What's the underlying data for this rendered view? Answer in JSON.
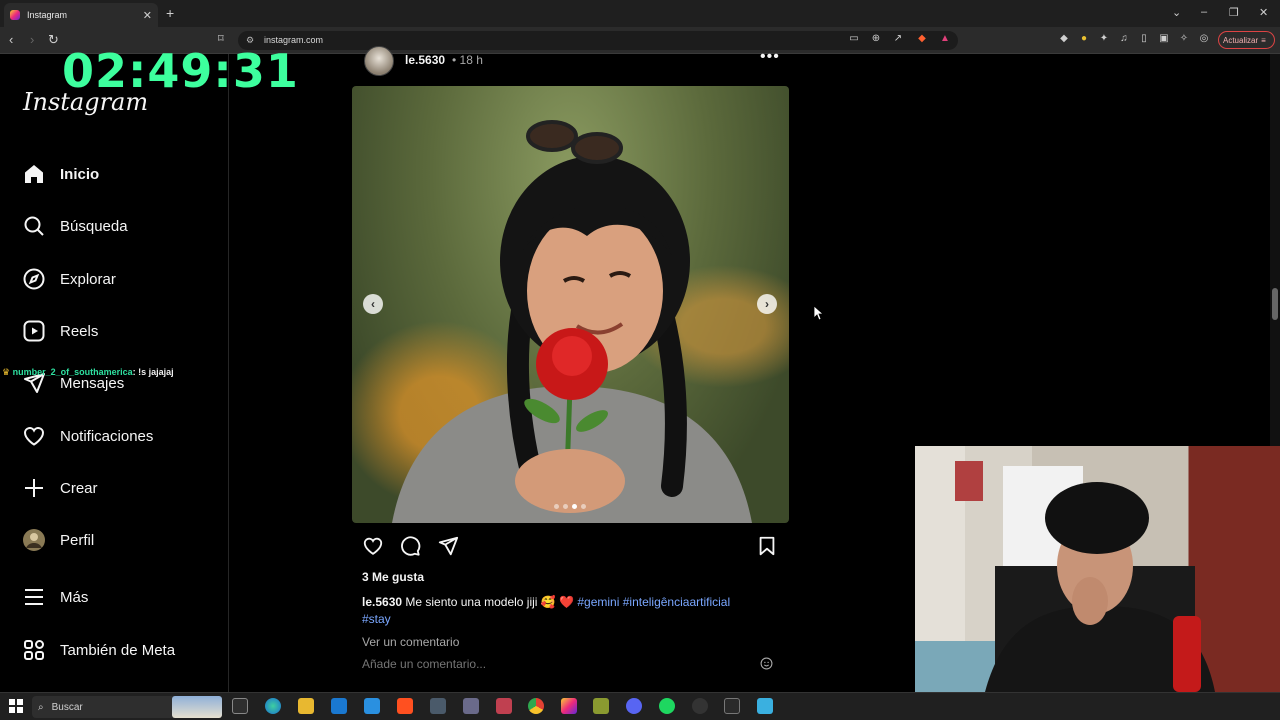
{
  "browser": {
    "tab_title": "Instagram",
    "new_tab_icon": "plus-icon",
    "url": "instagram.com",
    "update_label": "Actualizar"
  },
  "overlay": {
    "timer": "02:49:31",
    "chat_user": "number_2_of_southamerica",
    "chat_message": ": !s jajajaj"
  },
  "sidebar": {
    "logo": "Instagram",
    "items": [
      {
        "label": "Inicio",
        "icon": "home-icon"
      },
      {
        "label": "Búsqueda",
        "icon": "search-icon"
      },
      {
        "label": "Explorar",
        "icon": "compass-icon"
      },
      {
        "label": "Reels",
        "icon": "reels-icon"
      },
      {
        "label": "Mensajes",
        "icon": "messages-icon"
      },
      {
        "label": "Notificaciones",
        "icon": "heart-icon"
      },
      {
        "label": "Crear",
        "icon": "plus-icon"
      },
      {
        "label": "Perfil",
        "icon": "avatar-icon"
      },
      {
        "label": "Más",
        "icon": "menu-icon"
      },
      {
        "label": "También de Meta",
        "icon": "meta-apps-icon"
      }
    ]
  },
  "post": {
    "username": "le.5630",
    "time": "• 18 h",
    "likes": "3 Me gusta",
    "caption_user": "le.5630",
    "caption_text": "Me siento una modelo jiji 🥰 ❤️",
    "hashtags": [
      "#gemini",
      "#inteligênciaartificial",
      "#stay"
    ],
    "view_comments": "Ver un comentario",
    "add_comment_placeholder": "Añade un comentario...",
    "carousel_index": 3,
    "carousel_count": 4
  },
  "taskbar": {
    "search_label": "Buscar"
  },
  "colors": {
    "timer": "#3dff9e",
    "hashtag": "#7aa7ff",
    "background": "#000000"
  }
}
